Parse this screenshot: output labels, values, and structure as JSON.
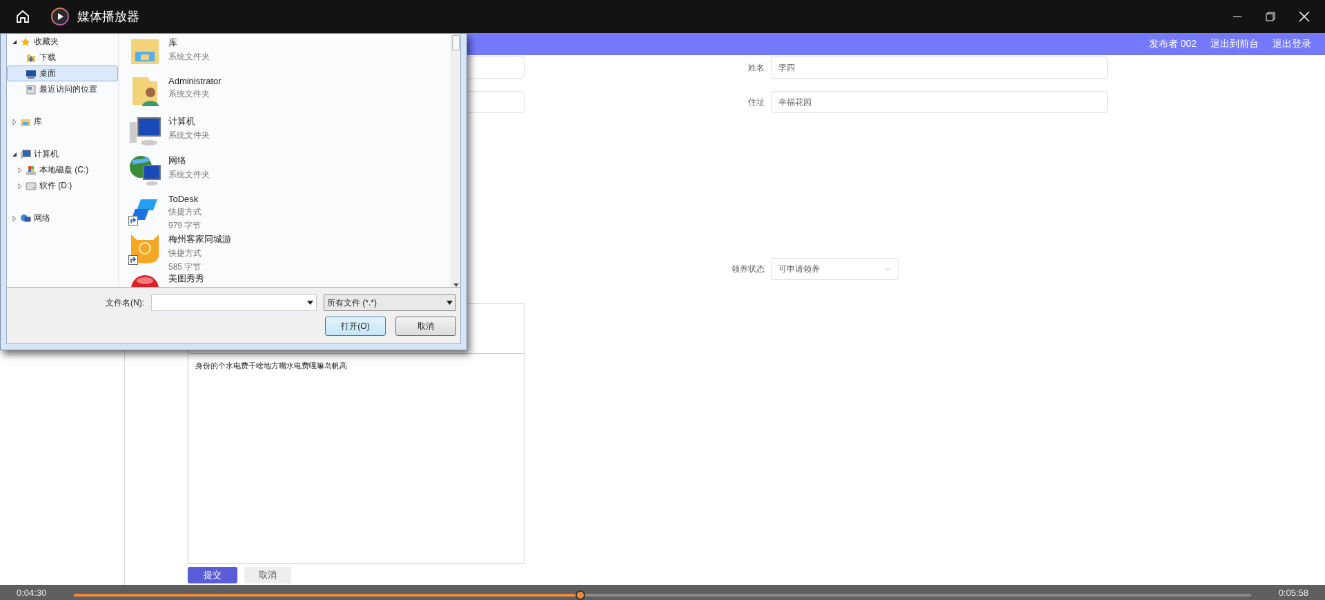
{
  "titlebar": {
    "title": "媒体播放器"
  },
  "header": {
    "links": [
      "发布者 002",
      "退出到前台",
      "退出登录"
    ]
  },
  "form": {
    "fields": [
      {
        "kind": "input",
        "label": "姓名",
        "value": "李四"
      },
      {
        "kind": "input",
        "label": "住址",
        "value": "幸福花园"
      },
      {
        "kind": "select",
        "label": "领养状态",
        "value": "可申请领养"
      }
    ],
    "editor": {
      "text": "身份的个水电费干啥地方嘴水电费嘎嘛岛帆高"
    },
    "buttons": [
      {
        "label": "提交",
        "kind": "primary"
      },
      {
        "label": "取消",
        "kind": "plain"
      }
    ]
  },
  "file_dialog": {
    "nav": [
      {
        "label": "收藏夹",
        "kind": "star",
        "expanded": true,
        "selected": false,
        "children": [
          {
            "label": "下载",
            "kind": "download",
            "selected": false
          },
          {
            "label": "桌面",
            "kind": "desktop",
            "selected": true
          },
          {
            "label": "最近访问的位置",
            "kind": "recent",
            "selected": false
          }
        ]
      },
      {
        "label": "库",
        "kind": "library",
        "expanded": false,
        "selected": false
      },
      {
        "label": "计算机",
        "kind": "computer",
        "expanded": true,
        "selected": false,
        "children": [
          {
            "label": "本地磁盘 (C:)",
            "kind": "disk",
            "expanded": false,
            "selected": false
          },
          {
            "label": "软件 (D:)",
            "kind": "drive",
            "expanded": false,
            "selected": false
          }
        ]
      },
      {
        "label": "网络",
        "kind": "network",
        "expanded": false,
        "selected": false
      }
    ],
    "files": [
      {
        "name": "库",
        "kind": "library",
        "shortcut": false,
        "details": [
          "系统文件夹"
        ]
      },
      {
        "name": "Administrator",
        "kind": "user",
        "shortcut": false,
        "details": [
          "系统文件夹"
        ]
      },
      {
        "name": "计算机",
        "kind": "computer",
        "shortcut": false,
        "details": [
          "系统文件夹"
        ]
      },
      {
        "name": "网络",
        "kind": "network",
        "shortcut": false,
        "details": [
          "系统文件夹"
        ]
      },
      {
        "name": "ToDesk",
        "kind": "todesk",
        "shortcut": true,
        "details": [
          "快捷方式",
          "979 字节"
        ]
      },
      {
        "name": "梅州客家同城游",
        "kind": "mascot",
        "shortcut": true,
        "details": [
          "快捷方式",
          "585 字节"
        ]
      },
      {
        "name": "美图秀秀",
        "kind": "redball"
      }
    ],
    "filename_label": "文件名(N):",
    "filetype": "所有文件 (*.*)",
    "buttons": [
      {
        "label": "打开(O)",
        "selected": true
      },
      {
        "label": "取消",
        "selected": false
      }
    ]
  },
  "player": {
    "elapsed": "0:04:30",
    "total": "0:05:58",
    "level": 0.43
  }
}
